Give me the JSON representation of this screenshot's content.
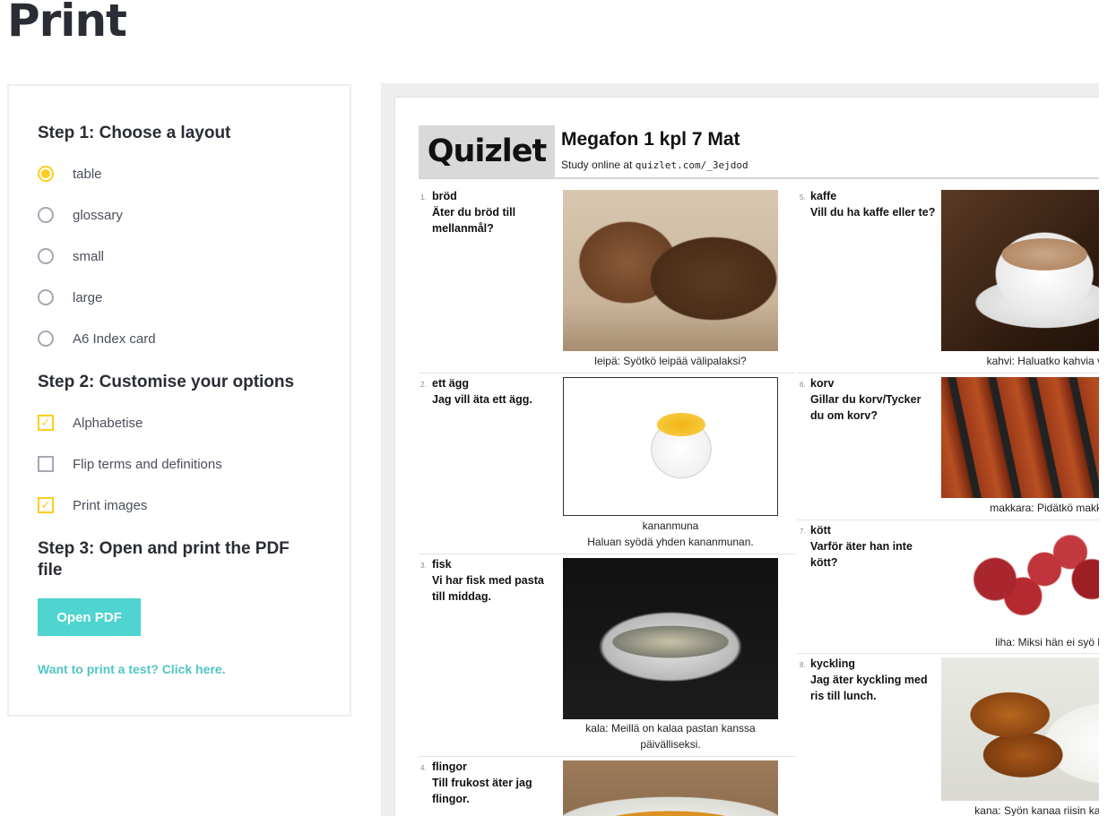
{
  "page": {
    "title": "Print"
  },
  "options": {
    "step1_title": "Step 1: Choose a layout",
    "layouts": [
      {
        "label": "table",
        "selected": true
      },
      {
        "label": "glossary",
        "selected": false
      },
      {
        "label": "small",
        "selected": false
      },
      {
        "label": "large",
        "selected": false
      },
      {
        "label": "A6 Index card",
        "selected": false
      }
    ],
    "step2_title": "Step 2: Customise your options",
    "toggles": [
      {
        "label": "Alphabetise",
        "checked": true
      },
      {
        "label": "Flip terms and definitions",
        "checked": false
      },
      {
        "label": "Print images",
        "checked": true
      }
    ],
    "step3_title": "Step 3: Open and print the PDF file",
    "open_pdf_label": "Open PDF",
    "test_link_label": "Want to print a test? Click here."
  },
  "preview": {
    "logo_text": "Quizlet",
    "set_title": "Megafon 1 kpl 7 Mat",
    "study_prefix": "Study online at",
    "study_url": "quizlet.com/_3ejdod",
    "cards": [
      {
        "num": "1.",
        "term": "bröd",
        "definition": "Äter du bröd till mellanmål?",
        "caption": "leipä: Syötkö leipää välipalaksi?",
        "image": "bread-photo"
      },
      {
        "num": "2.",
        "term": "ett ägg",
        "definition": "Jag vill äta ett ägg.",
        "caption": "kananmuna\nHaluan syödä yhden kananmunan.",
        "image": "egg-photo"
      },
      {
        "num": "3.",
        "term": "fisk",
        "definition": "Vi har fisk med pasta till middag.",
        "caption": "kala: Meillä on kalaa pastan kanssa päivälliseksi.",
        "image": "fish-photo"
      },
      {
        "num": "4.",
        "term": "flingor",
        "definition": "Till frukost äter jag flingor.",
        "caption": "",
        "image": "cereal-photo"
      },
      {
        "num": "5.",
        "term": "kaffe",
        "definition": "Vill du ha kaffe eller te?",
        "caption": "kahvi: Haluatko kahvia vai",
        "image": "coffee-photo"
      },
      {
        "num": "6.",
        "term": "korv",
        "definition": "Gillar du korv/Tycker du om korv?",
        "caption": "makkara: Pidätkö makka",
        "image": "sausage-photo"
      },
      {
        "num": "7.",
        "term": "kött",
        "definition": "Varför äter han inte kött?",
        "caption": "liha: Miksi hän ei syö li",
        "image": "meat-photo"
      },
      {
        "num": "8.",
        "term": "kyckling",
        "definition": "Jag äter kyckling med ris till lunch.",
        "caption": "kana: Syön kanaa riisin kanssa",
        "image": "chicken-photo"
      }
    ]
  }
}
